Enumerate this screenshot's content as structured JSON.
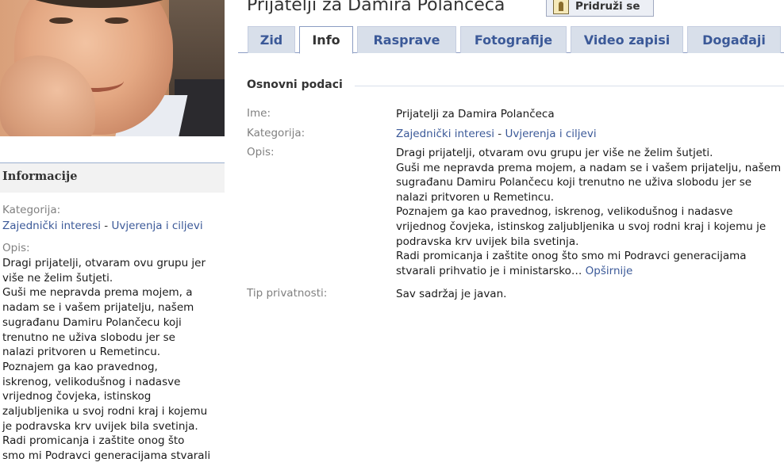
{
  "group": {
    "title": "Prijatelji za Damira Polančeca",
    "join_label": "Pridruži se"
  },
  "tabs": [
    {
      "label": "Zid"
    },
    {
      "label": "Info"
    },
    {
      "label": "Rasprave"
    },
    {
      "label": "Fotografije"
    },
    {
      "label": "Video zapisi"
    },
    {
      "label": "Događaji"
    }
  ],
  "sidebar": {
    "heading": "Informacije",
    "category_label": "Kategorija:",
    "category_1": "Zajednički interesi",
    "category_sep": " - ",
    "category_2": "Uvjerenja i ciljevi",
    "description_label": "Opis:",
    "description_lines": [
      "Dragi prijatelji, otvaram ovu grupu jer",
      "više ne želim šutjeti.",
      "Guši me nepravda prema mojem, a",
      "nadam se i vašem prijatelju, našem",
      "sugrađanu Damiru Polančecu koji",
      "trenutno ne uživa slobodu jer se",
      "nalazi pritvoren u Remetincu.",
      "Poznajem ga kao pravednog,",
      "iskrenog, velikodušnog i nadasve",
      "vrijednog čovjeka, istinskog",
      "zaljubljenika u svoj rodni kraj i kojemu",
      "je podravska krv uvijek bila svetinja.",
      "Radi promicanja i zaštite onog što",
      "smo mi Podravci generacijama stvarali"
    ]
  },
  "info": {
    "section_title": "Osnovni podaci",
    "name_label": "Ime:",
    "name_value": "Prijatelji za Damira Polančeca",
    "category_label": "Kategorija:",
    "category_1": "Zajednički interesi",
    "category_sep": " - ",
    "category_2": "Uvjerenja i ciljevi",
    "description_label": "Opis:",
    "description_lines": [
      "Dragi prijatelji, otvaram ovu grupu jer više ne želim šutjeti.",
      "Guši me nepravda prema mojem, a nadam se i vašem prijatelju, našem",
      "sugrađanu Damiru Polančecu koji trenutno ne uživa slobodu jer se",
      "nalazi pritvoren u Remetincu.",
      "Poznajem ga kao pravednog, iskrenog, velikodušnog i nadasve",
      "vrijednog čovjeka, istinskog zaljubljenika u svoj rodni kraj i kojemu je",
      "podravska krv uvijek bila svetinja.",
      "Radi promicanja i zaštite onog što smo mi Podravci generacijama",
      "stvarali prihvatio je i ministarsko…"
    ],
    "more_link": "Opširnije",
    "privacy_label": "Tip privatnosti:",
    "privacy_value": "Sav sadržaj je javan."
  }
}
